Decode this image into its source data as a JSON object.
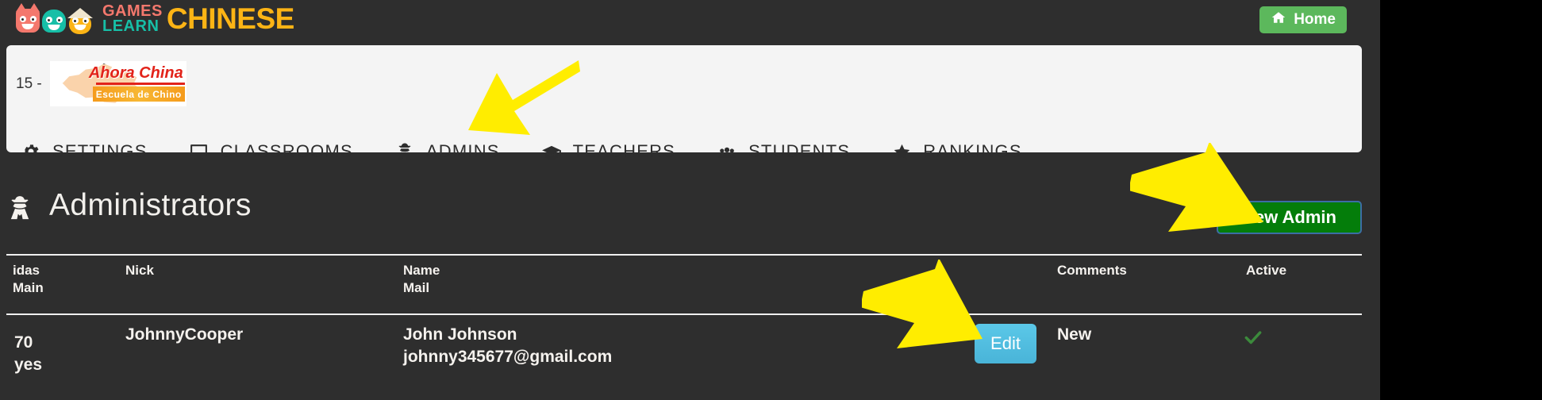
{
  "topbar": {
    "brand": {
      "games": "GAMES",
      "learn": "LEARN",
      "chinese": "CHINESE",
      "mascot_icons": [
        "pink-monster-icon",
        "teal-monster-icon",
        "chinese-hat-monster-icon"
      ]
    },
    "home_button": {
      "label": "Home",
      "icon": "home-icon",
      "color": "#5cb85c"
    }
  },
  "school": {
    "number_label": "15 -",
    "logo_title": "Ahora China",
    "logo_subtitle": "Escuela de Chino",
    "logo_map": "china-map-icon"
  },
  "nav": {
    "items": [
      {
        "label": "SETTINGS",
        "icon": "gear-icon"
      },
      {
        "label": "CLASSROOMS",
        "icon": "monitor-icon"
      },
      {
        "label": "ADMINS",
        "icon": "user-secret-icon"
      },
      {
        "label": "TEACHERS",
        "icon": "graduation-cap-icon"
      },
      {
        "label": "STUDENTS",
        "icon": "users-group-icon"
      },
      {
        "label": "RANKINGS",
        "icon": "star-icon"
      }
    ]
  },
  "admin_section": {
    "title": "Administrators",
    "title_icon": "user-secret-icon",
    "new_admin_button": {
      "label": "New Admin",
      "color": "#047d0a",
      "focus_border": "#3b6ea5"
    }
  },
  "table": {
    "headers": {
      "ids_line1": "idas",
      "ids_line2": "Main",
      "nick": "Nick",
      "name_line1": "Name",
      "name_line2": "Mail",
      "comments": "Comments",
      "active": "Active"
    },
    "rows": [
      {
        "id": "70",
        "main": "yes",
        "nick": "JohnnyCooper",
        "name": "John Johnson",
        "mail": "johnny345677@gmail.com",
        "edit_label": "Edit",
        "comments": "New",
        "active": true,
        "active_icon": "check-icon",
        "active_color": "#3c8a3c"
      }
    ]
  },
  "annotations": {
    "arrow_color": "#ffed00",
    "arrows": [
      {
        "name": "arrow-to-admins",
        "points_to": "ADMINS",
        "direction": "down-left"
      },
      {
        "name": "arrow-to-new-admin",
        "points_to": "New Admin",
        "direction": "down-right"
      },
      {
        "name": "arrow-to-edit",
        "points_to": "Edit",
        "direction": "down-right"
      }
    ]
  }
}
